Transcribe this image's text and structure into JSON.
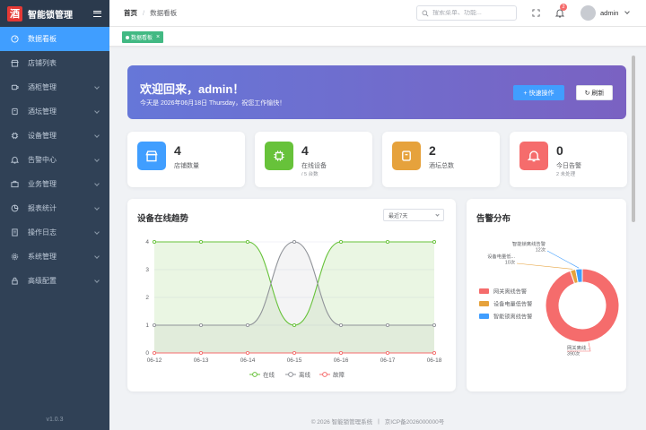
{
  "app": {
    "logo_char": "酒",
    "title": "智能锁管理",
    "version": "v1.0.3"
  },
  "sidebar": {
    "items": [
      {
        "label": "数据看板",
        "icon": "dashboard-icon",
        "active": true,
        "has_arrow": false
      },
      {
        "label": "店铺列表",
        "icon": "store-icon",
        "active": false,
        "has_arrow": false
      },
      {
        "label": "酒柜管理",
        "icon": "cabinet-icon",
        "active": false,
        "has_arrow": true
      },
      {
        "label": "酒坛管理",
        "icon": "jar-icon",
        "active": false,
        "has_arrow": true
      },
      {
        "label": "设备管理",
        "icon": "chip-icon",
        "active": false,
        "has_arrow": true
      },
      {
        "label": "告警中心",
        "icon": "bell-icon",
        "active": false,
        "has_arrow": true
      },
      {
        "label": "业务管理",
        "icon": "briefcase-icon",
        "active": false,
        "has_arrow": true
      },
      {
        "label": "报表统计",
        "icon": "pie-icon",
        "active": false,
        "has_arrow": true
      },
      {
        "label": "操作日志",
        "icon": "log-icon",
        "active": false,
        "has_arrow": true
      },
      {
        "label": "系统管理",
        "icon": "gear-icon",
        "active": false,
        "has_arrow": true
      },
      {
        "label": "高级配置",
        "icon": "lock-icon",
        "active": false,
        "has_arrow": true
      }
    ]
  },
  "header": {
    "breadcrumb_home": "首页",
    "breadcrumb_sep": "/",
    "breadcrumb_current": "数据看板",
    "search_placeholder": "搜索菜单、功能...",
    "notification_count": "2",
    "username": "admin"
  },
  "tags": {
    "active_tag": "数据看板",
    "close": "×"
  },
  "welcome": {
    "title": "欢迎回来，admin！",
    "subtitle": "今天是 2026年06月18日 Thursday，祝您工作愉快！",
    "quick_action": "+ 快速操作",
    "refresh": "↻ 刷新"
  },
  "stats": [
    {
      "value": "4",
      "label": "店铺数量",
      "extra": "",
      "color": "#409eff",
      "icon": "store-icon"
    },
    {
      "value": "4",
      "label": "在线设备",
      "extra": "/ 5 台数",
      "color": "#67c23a",
      "icon": "chip-icon"
    },
    {
      "value": "2",
      "label": "酒坛总数",
      "extra": "",
      "color": "#e6a23c",
      "icon": "jar-icon"
    },
    {
      "value": "0",
      "label": "今日告警",
      "extra": "2 未处理",
      "color": "#f56c6c",
      "icon": "bell-icon"
    }
  ],
  "trend_panel": {
    "title": "设备在线趋势",
    "range": "最近7天"
  },
  "alarm_panel": {
    "title": "告警分布"
  },
  "footer": {
    "copyright": "© 2026 智能锁管理系统",
    "sep": "|",
    "icp": "京ICP备2026000000号"
  },
  "chart_data": [
    {
      "type": "line",
      "x": [
        "06-12",
        "06-13",
        "06-14",
        "06-15",
        "06-16",
        "06-17",
        "06-18"
      ],
      "series": [
        {
          "name": "在线",
          "values": [
            4,
            4,
            4,
            1,
            4,
            4,
            4
          ],
          "color": "#67c23a"
        },
        {
          "name": "离线",
          "values": [
            1,
            1,
            1,
            4,
            1,
            1,
            1
          ],
          "color": "#909399"
        },
        {
          "name": "故障",
          "values": [
            0,
            0,
            0,
            0,
            0,
            0,
            0
          ],
          "color": "#f56c6c"
        }
      ],
      "ylim": [
        0,
        4
      ],
      "yticks": [
        0,
        1,
        2,
        3,
        4
      ],
      "smooth": true,
      "area": true,
      "legend": "bottom",
      "grid": true
    },
    {
      "type": "pie",
      "donut": true,
      "legend": "left",
      "slices": [
        {
          "name": "网关离线告警",
          "value": 390,
          "label": "网关离线...\n390次",
          "color": "#f56c6c"
        },
        {
          "name": "设备电量低告警",
          "value": 10,
          "label": "设备电量低...\n10次",
          "color": "#e6a23c"
        },
        {
          "name": "智能锁离线告警",
          "value": 12,
          "label": "智能锁离线告警\n12次",
          "color": "#409eff"
        }
      ]
    }
  ]
}
